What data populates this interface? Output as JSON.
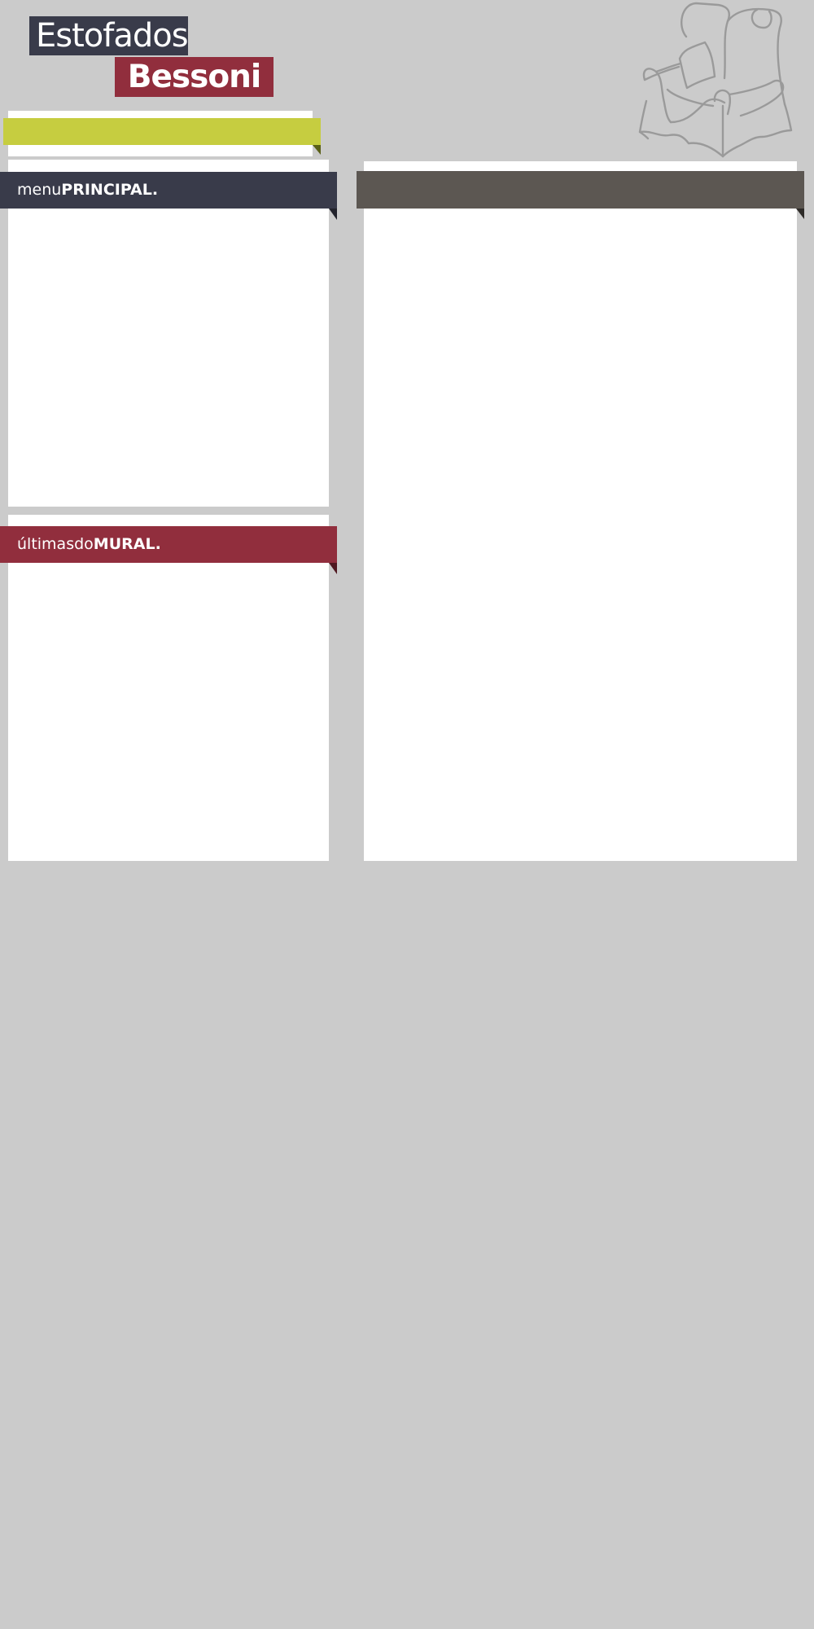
{
  "brand": {
    "line1": "Estofados",
    "line2": "Bessoni",
    "colors": {
      "navy": "#393b4a",
      "wine": "#912e3d",
      "lime": "#c6cd40",
      "taupe": "#5c5752",
      "page_bg": "#cbcbcb"
    }
  },
  "header": {
    "illustration_icon": "armchair-icon"
  },
  "search_bar": {
    "color": "#c6cd40"
  },
  "menu": {
    "title_light": "menu",
    "title_bold": "PRINCIPAL."
  },
  "mural": {
    "title_light": "últimasdo",
    "title_bold": "MURAL."
  },
  "main": {
    "title": ""
  }
}
